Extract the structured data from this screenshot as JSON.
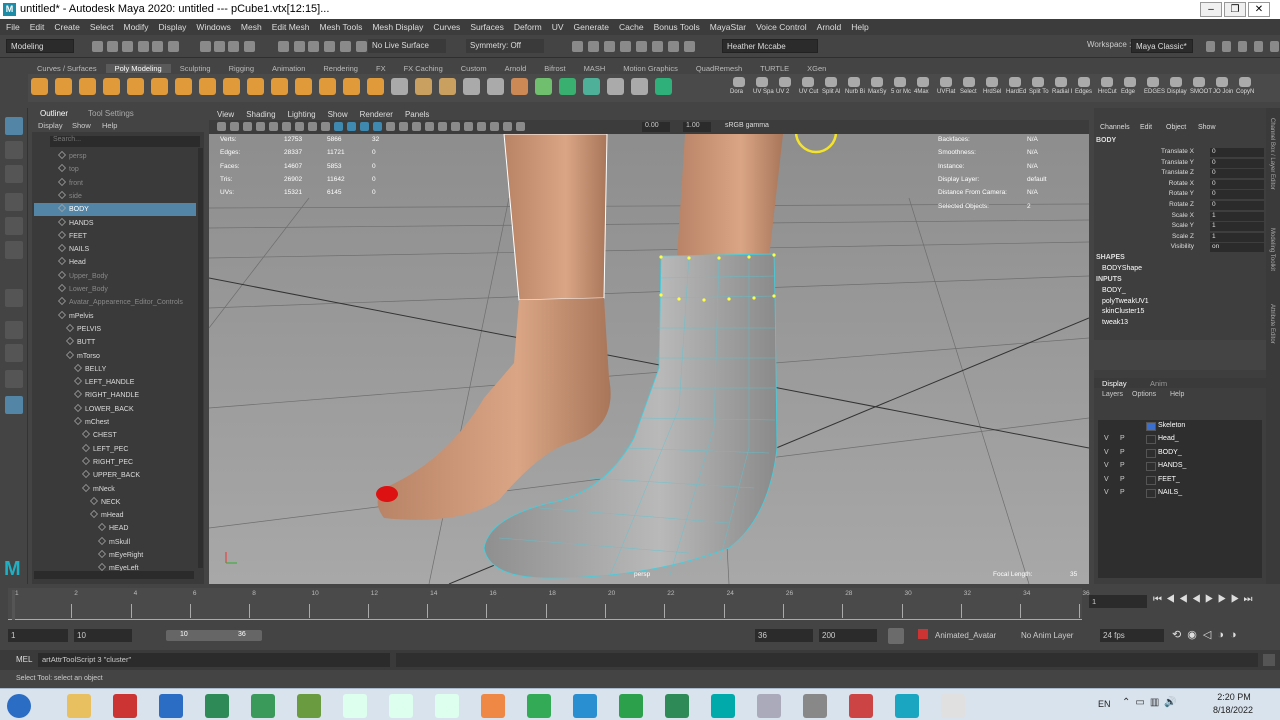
{
  "title": "untitled* - Autodesk Maya 2020: untitled   ---   pCube1.vtx[12:15]...",
  "app_icon": "M",
  "menubar": [
    "File",
    "Edit",
    "Create",
    "Select",
    "Modify",
    "Display",
    "Windows",
    "Mesh",
    "Edit Mesh",
    "Mesh Tools",
    "Mesh Display",
    "Curves",
    "Surfaces",
    "Deform",
    "UV",
    "Generate",
    "Cache",
    "Bonus Tools",
    "MayaStar",
    "Voice Control",
    "Arnold",
    "Help"
  ],
  "status": {
    "mode": "Modeling",
    "live_surface": "No Live Surface",
    "symmetry": "Symmetry: Off",
    "user": "Heather Mccabe",
    "workspace_label": "Workspace :",
    "workspace": "Maya Classic*"
  },
  "shelf_tabs": [
    "Curves / Surfaces",
    "Poly Modeling",
    "Sculpting",
    "Rigging",
    "Animation",
    "Rendering",
    "FX",
    "FX Caching",
    "Custom",
    "Arnold",
    "Bifrost",
    "MASH",
    "Motion Graphics",
    "QuadRemesh",
    "TURTLE",
    "XGen"
  ],
  "shelf_labels": [
    "Dora",
    "UV Spa",
    "UV 2",
    "UV Cut",
    "Split Al",
    "Nurb Bi",
    "MaxSy",
    "5 or Mc",
    "4Max",
    "UVFlat",
    "Select",
    "HrdSel",
    "HardEd",
    "Split To",
    "Radial I",
    "Edges",
    "HrcCut",
    "Edge",
    "EDGES",
    "Display",
    "SMOOT",
    "JO Join",
    "CopyN"
  ],
  "outliner": {
    "tabs": [
      "Outliner",
      "Tool Settings"
    ],
    "menus": [
      "Display",
      "Show",
      "Help"
    ],
    "search": "Search...",
    "rows": [
      {
        "label": "persp",
        "indent": 0,
        "grey": true
      },
      {
        "label": "top",
        "indent": 0,
        "grey": true
      },
      {
        "label": "front",
        "indent": 0,
        "grey": true
      },
      {
        "label": "side",
        "indent": 0,
        "grey": true
      },
      {
        "label": "BODY",
        "indent": 0,
        "sel": true
      },
      {
        "label": "HANDS",
        "indent": 0
      },
      {
        "label": "FEET",
        "indent": 0
      },
      {
        "label": "NAILS",
        "indent": 0
      },
      {
        "label": "Head",
        "indent": 0
      },
      {
        "label": "Upper_Body",
        "indent": 0,
        "grey": true
      },
      {
        "label": "Lower_Body",
        "indent": 0,
        "grey": true
      },
      {
        "label": "Avatar_Appearence_Editor_Controls",
        "indent": 0,
        "grey": true
      },
      {
        "label": "mPelvis",
        "indent": 0
      },
      {
        "label": "PELVIS",
        "indent": 1
      },
      {
        "label": "BUTT",
        "indent": 1
      },
      {
        "label": "mTorso",
        "indent": 1
      },
      {
        "label": "BELLY",
        "indent": 2
      },
      {
        "label": "LEFT_HANDLE",
        "indent": 2
      },
      {
        "label": "RIGHT_HANDLE",
        "indent": 2
      },
      {
        "label": "LOWER_BACK",
        "indent": 2
      },
      {
        "label": "mChest",
        "indent": 2
      },
      {
        "label": "CHEST",
        "indent": 3
      },
      {
        "label": "LEFT_PEC",
        "indent": 3
      },
      {
        "label": "RIGHT_PEC",
        "indent": 3
      },
      {
        "label": "UPPER_BACK",
        "indent": 3
      },
      {
        "label": "mNeck",
        "indent": 3
      },
      {
        "label": "NECK",
        "indent": 4
      },
      {
        "label": "mHead",
        "indent": 4
      },
      {
        "label": "HEAD",
        "indent": 5
      },
      {
        "label": "mSkull",
        "indent": 5
      },
      {
        "label": "mEyeRight",
        "indent": 5
      },
      {
        "label": "mEyeLeft",
        "indent": 5
      }
    ]
  },
  "viewport": {
    "menus": [
      "View",
      "Shading",
      "Lighting",
      "Show",
      "Renderer",
      "Panels"
    ],
    "field1": "0.00",
    "field2": "1.00",
    "colorspace": "sRGB gamma",
    "camera": "persp",
    "focal_label": "Focal Length:",
    "focal": "35",
    "hud_left": [
      [
        "Verts:",
        "12753",
        "5866",
        "32"
      ],
      [
        "Edges:",
        "28337",
        "11721",
        "0"
      ],
      [
        "Faces:",
        "14607",
        "5853",
        "0"
      ],
      [
        "Tris:",
        "26902",
        "11642",
        "0"
      ],
      [
        "UVs:",
        "15321",
        "6145",
        "0"
      ]
    ],
    "hud_right": [
      [
        "Backfaces:",
        "N/A"
      ],
      [
        "Smoothness:",
        "N/A"
      ],
      [
        "Instance:",
        "N/A"
      ],
      [
        "Display Layer:",
        "default"
      ],
      [
        "Distance From Camera:",
        "N/A"
      ],
      [
        "Selected Objects:",
        "2"
      ]
    ]
  },
  "channels": {
    "menus": [
      "Channels",
      "Edit",
      "Object",
      "Show"
    ],
    "object": "BODY",
    "attrs": [
      [
        "Translate X",
        "0"
      ],
      [
        "Translate Y",
        "0"
      ],
      [
        "Translate Z",
        "0"
      ],
      [
        "Rotate X",
        "0"
      ],
      [
        "Rotate Y",
        "0"
      ],
      [
        "Rotate Z",
        "0"
      ],
      [
        "Scale X",
        "1"
      ],
      [
        "Scale Y",
        "1"
      ],
      [
        "Scale Z",
        "1"
      ],
      [
        "Visibility",
        "on"
      ]
    ],
    "shapes_label": "SHAPES",
    "shape": "BODYShape",
    "inputs_label": "INPUTS",
    "inputs": [
      "BODY_",
      "polyTweakUV1",
      "skinCluster15",
      "tweak13"
    ]
  },
  "layers": {
    "tabs": [
      "Display",
      "Anim"
    ],
    "menus": [
      "Layers",
      "Options",
      "Help"
    ],
    "rows": [
      {
        "v": "",
        "p": "",
        "name": "Skeleton",
        "color": "#3a6fd0"
      },
      {
        "v": "V",
        "p": "P",
        "name": "Head_"
      },
      {
        "v": "V",
        "p": "P",
        "name": "BODY_"
      },
      {
        "v": "V",
        "p": "P",
        "name": "HANDS_"
      },
      {
        "v": "V",
        "p": "P",
        "name": "FEET_"
      },
      {
        "v": "V",
        "p": "P",
        "name": "NAILS_"
      }
    ]
  },
  "right_strip": [
    "Channel Box / Layer Editor",
    "Modeling Toolkit",
    "Attribute Editor"
  ],
  "timeline": {
    "ticks": [
      "1",
      "2",
      "4",
      "6",
      "8",
      "10",
      "12",
      "14",
      "16",
      "18",
      "20",
      "22",
      "24",
      "26",
      "28",
      "30",
      "32",
      "34",
      "36"
    ],
    "current": "1"
  },
  "range": {
    "start": "1",
    "start2": "10",
    "slider_min": "10",
    "slider_max": "36",
    "end": "36",
    "end2": "200",
    "character": "Animated_Avatar",
    "anim_layer": "No Anim Layer",
    "fps": "24 fps"
  },
  "cmd": {
    "lang": "MEL",
    "text": "artAttrToolScript 3 \"cluster\""
  },
  "help": "Select Tool: select an object",
  "tray": {
    "lang": "EN",
    "time": "2:20 PM",
    "date": "8/18/2022"
  }
}
